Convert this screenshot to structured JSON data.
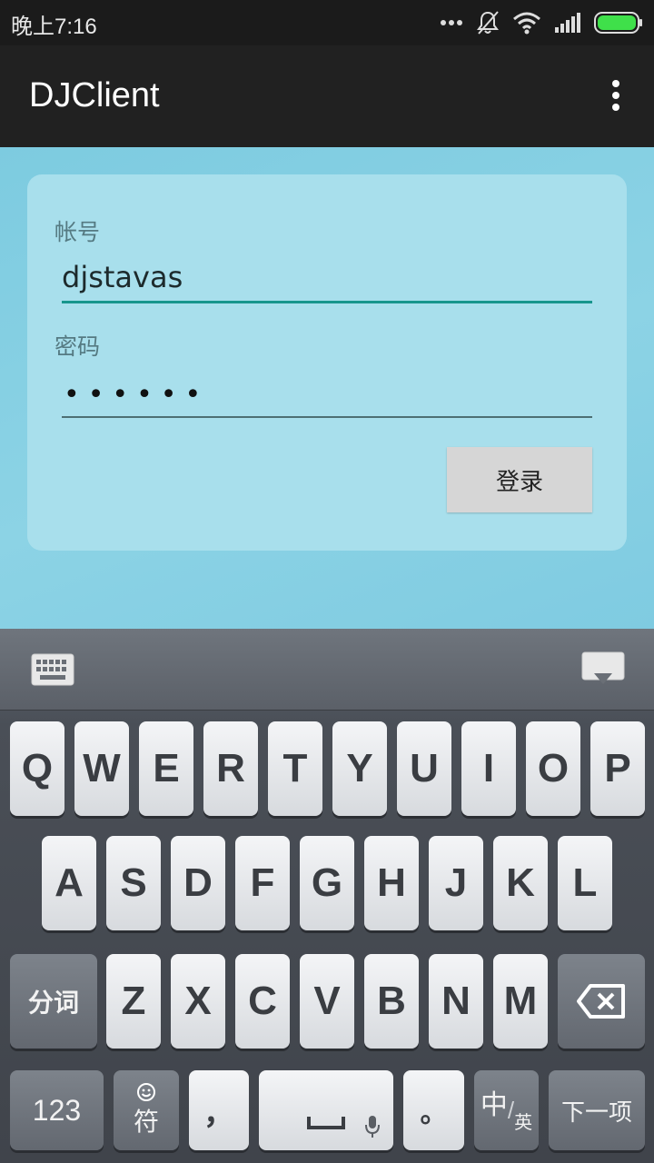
{
  "status_bar": {
    "time": "晚上7:16"
  },
  "app_bar": {
    "title": "DJClient"
  },
  "login_form": {
    "account_label": "帐号",
    "account_value": "djstavas",
    "password_label": "密码",
    "password_masked": "••••••",
    "login_button": "登录"
  },
  "keyboard": {
    "row1": [
      "Q",
      "W",
      "E",
      "R",
      "T",
      "Y",
      "U",
      "I",
      "O",
      "P"
    ],
    "row2": [
      "A",
      "S",
      "D",
      "F",
      "G",
      "H",
      "J",
      "K",
      "L"
    ],
    "row3": [
      "Z",
      "X",
      "C",
      "V",
      "B",
      "N",
      "M"
    ],
    "segment_key": "分词",
    "numbers_key": "123",
    "symbols_key": "符",
    "comma_key": "，",
    "period_key": "。",
    "lang_key_main": "中",
    "lang_key_sub": "英",
    "next_key": "下一项"
  },
  "colors": {
    "accent_underline": "#17968d",
    "app_bar": "#212121",
    "content_bg": "#7dcbe0"
  }
}
